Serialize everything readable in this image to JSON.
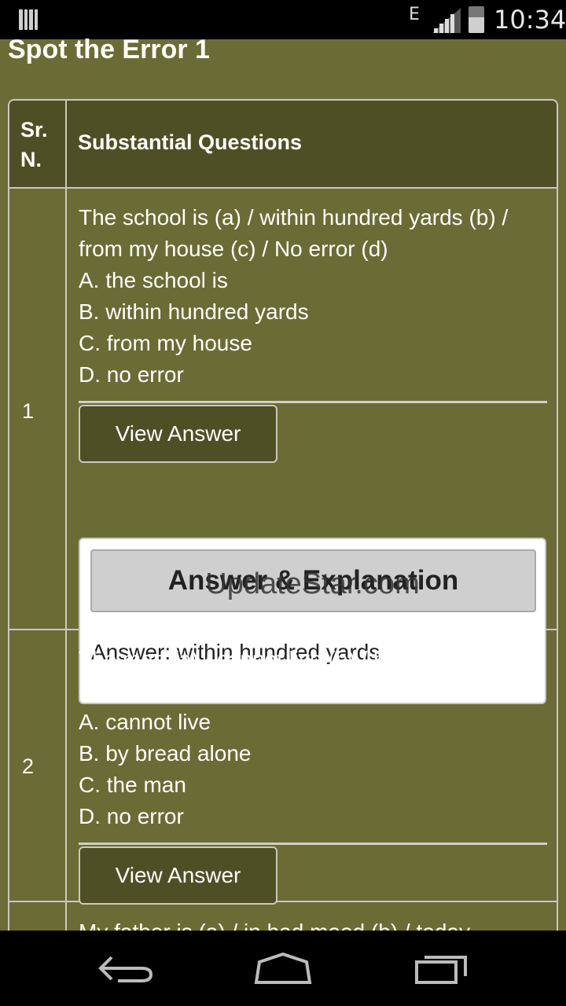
{
  "status_bar": {
    "network": "E",
    "time": "10:34"
  },
  "page": {
    "title": "Spot the Error 1"
  },
  "table": {
    "header_sr": "Sr. N.",
    "header_questions": "Substantial Questions"
  },
  "questions": [
    {
      "number": "1",
      "text": "The school is (a) / within hundred yards (b) / from my house (c) / No error (d)",
      "options": [
        "A. the school is",
        "B. within hundred yards",
        "C. from my house",
        "D. no error"
      ],
      "button": "View Answer",
      "answer_heading": "Answer & Explanation",
      "answer_text": "Answer: within hundred yards"
    },
    {
      "number": "2",
      "text": "The man (a) / cannot live (b) / by bread alone (c) / No error (d)",
      "options": [
        "A. cannot live",
        "B. by bread alone",
        "C. the man",
        "D. no error"
      ],
      "button": "View Answer"
    },
    {
      "text": "My father is (a) / in bad mood (b) / today"
    }
  ],
  "watermark": "UpdateStar.com",
  "icons": [
    "signal-bars-icon",
    "cell-signal-icon",
    "battery-icon",
    "back-icon",
    "home-icon",
    "recents-icon"
  ]
}
